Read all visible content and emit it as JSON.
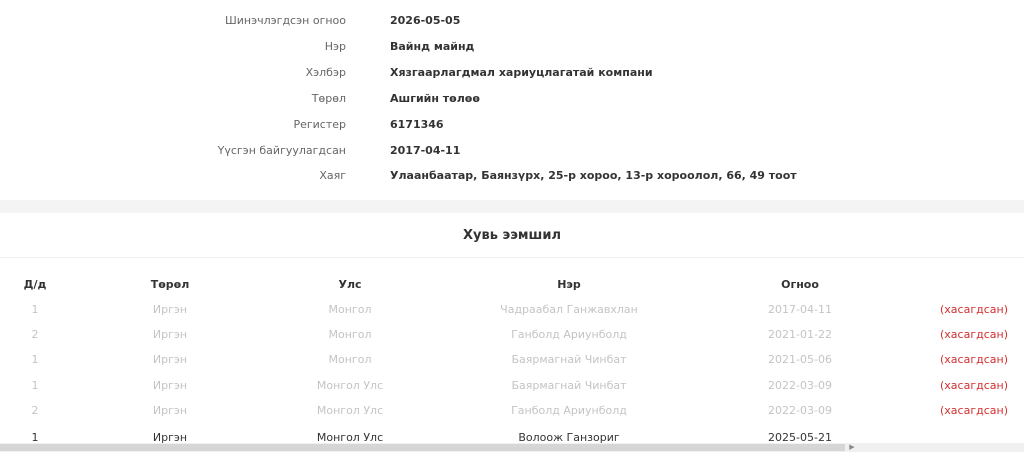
{
  "company_info": {
    "rows": [
      {
        "label": "Шинэчлэгдсэн огноо",
        "value": "2026-05-05"
      },
      {
        "label": "Нэр",
        "value": "Вайнд майнд"
      },
      {
        "label": "Хэлбэр",
        "value": "Хязгаарлагдмал хариуцлагатай компани"
      },
      {
        "label": "Төрөл",
        "value": "Ашгийн төлөө"
      },
      {
        "label": "Регистер",
        "value": "6171346"
      },
      {
        "label": "Үүсгэн байгуулагдсан",
        "value": "2017-04-11"
      },
      {
        "label": "Хаяг",
        "value": "Улаанбаатар, Баянзүрх, 25-р хороо, 13-р хороолол, 66, 49 тоот"
      }
    ]
  },
  "ownership": {
    "title": "Хувь ээмшил",
    "columns": [
      "Д/д",
      "Төрөл",
      "Улс",
      "Нэр",
      "Огноо"
    ],
    "rows": [
      {
        "no": "1",
        "type": "Иргэн",
        "country": "Монгол",
        "name": "Чадраабал Ганжавхлан",
        "date": "2017-04-11",
        "status": "(хасагдсан)",
        "faded": true
      },
      {
        "no": "2",
        "type": "Иргэн",
        "country": "Монгол",
        "name": "Ганболд Ариунболд",
        "date": "2021-01-22",
        "status": "(хасагдсан)",
        "faded": true
      },
      {
        "no": "1",
        "type": "Иргэн",
        "country": "Монгол",
        "name": "Баярмагнай Чинбат",
        "date": "2021-05-06",
        "status": "(хасагдсан)",
        "faded": true
      },
      {
        "no": "1",
        "type": "Иргэн",
        "country": "Монгол Улс",
        "name": "Баярмагнай Чинбат",
        "date": "2022-03-09",
        "status": "(хасагдсан)",
        "faded": true
      },
      {
        "no": "2",
        "type": "Иргэн",
        "country": "Монгол Улс",
        "name": "Ганболд Ариунболд",
        "date": "2022-03-09",
        "status": "(хасагдсан)",
        "faded": true
      },
      {
        "no": "1",
        "type": "Иргэн",
        "country": "Монгол Улс",
        "name": "Волоож Ганзориг",
        "date": "2025-05-21",
        "status": "",
        "faded": false
      }
    ]
  },
  "scrollbar": {
    "arrow_icon": "chevron-right-icon",
    "arrow_glyph": "▶"
  },
  "colors": {
    "removed_status": "#d32f2f",
    "faded_text": "#c4c4c4",
    "background": "#f4f4f4"
  }
}
